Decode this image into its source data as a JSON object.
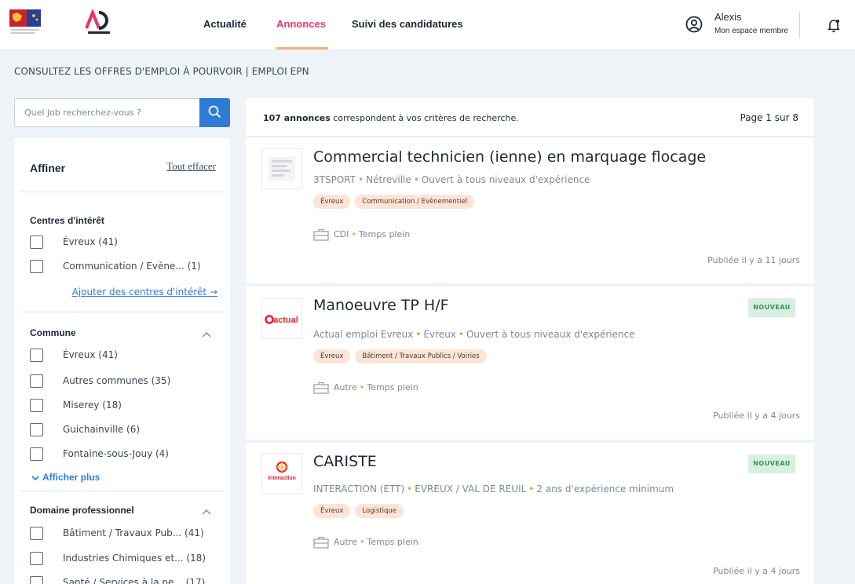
{
  "header": {
    "nav": [
      "Actualité",
      "Annonces",
      "Suivi des candidatures"
    ],
    "active_nav": "Annonces",
    "user_name": "Alexis",
    "user_sub": "Mon espace membre"
  },
  "page_heading": "CONSULTEZ LES OFFRES D'EMPLOI À POURVOIR | EMPLOI EPN",
  "search": {
    "placeholder": "Quel job recherchez-vous ?"
  },
  "sidebar": {
    "title": "Affiner",
    "clear_all": "Tout effacer",
    "interests": {
      "title": "Centres d'intérêt",
      "items": [
        "Évreux (41)",
        "Communication / Evène... (1)"
      ],
      "add_link": "Ajouter des centres d'intérêt →"
    },
    "commune": {
      "title": "Commune",
      "items": [
        "Évreux (41)",
        "Autres communes (35)",
        "Miserey (18)",
        "Guichainville (6)",
        "Fontaine-sous-Jouy (4)"
      ],
      "show_more": "Afficher plus"
    },
    "domaine": {
      "title": "Domaine professionnel",
      "items": [
        "Bâtiment / Travaux Pub... (41)",
        "Industries Chimiques et... (18)",
        "Santé / Services à la pe... (17)"
      ]
    }
  },
  "results": {
    "count_bold": "107 annonces",
    "count_rest": " correspondent à vos critères de recherche.",
    "page_info": "Page 1 sur 8",
    "jobs": [
      {
        "title": "Commercial technicien (ienne) en marquage flocage",
        "company": "3TSPORT",
        "location": "Nétreville",
        "experience": "Ouvert à tous niveaux d'expérience",
        "tags": [
          "Évreux",
          "Communication / Evènementiel"
        ],
        "contract": "CDI",
        "time": "Temps plein",
        "published": "Publiée il y a 11 jours",
        "is_new": false,
        "logo_text": ""
      },
      {
        "title": "Manoeuvre TP H/F",
        "company": "Actual emploi Evreux",
        "location": "Evreux",
        "experience": "Ouvert à tous niveaux d'expérience",
        "tags": [
          "Évreux",
          "Bâtiment / Travaux Publics / Voiries"
        ],
        "contract": "Autre",
        "time": "Temps plein",
        "published": "Publiée il y a 4 jours",
        "is_new": true,
        "logo_text": "actual"
      },
      {
        "title": "CARISTE",
        "company": "INTERACTION (ETT)",
        "location": "EVREUX / VAL DE REUIL",
        "experience": "2 ans d'expérience minimum",
        "tags": [
          "Évreux",
          "Logistique"
        ],
        "contract": "Autre",
        "time": "Temps plein",
        "published": "Publiée il y a 4 jours",
        "is_new": true,
        "logo_text": "Interaction"
      }
    ],
    "new_badge": "NOUVEAU"
  },
  "colors": {
    "accent": "#e8356d",
    "link": "#2e7bd6",
    "tag_bg": "#fde4d4",
    "badge_bg": "#d7f0df",
    "badge_text": "#3a8e5b",
    "meta_dot": "#f39a3d"
  }
}
